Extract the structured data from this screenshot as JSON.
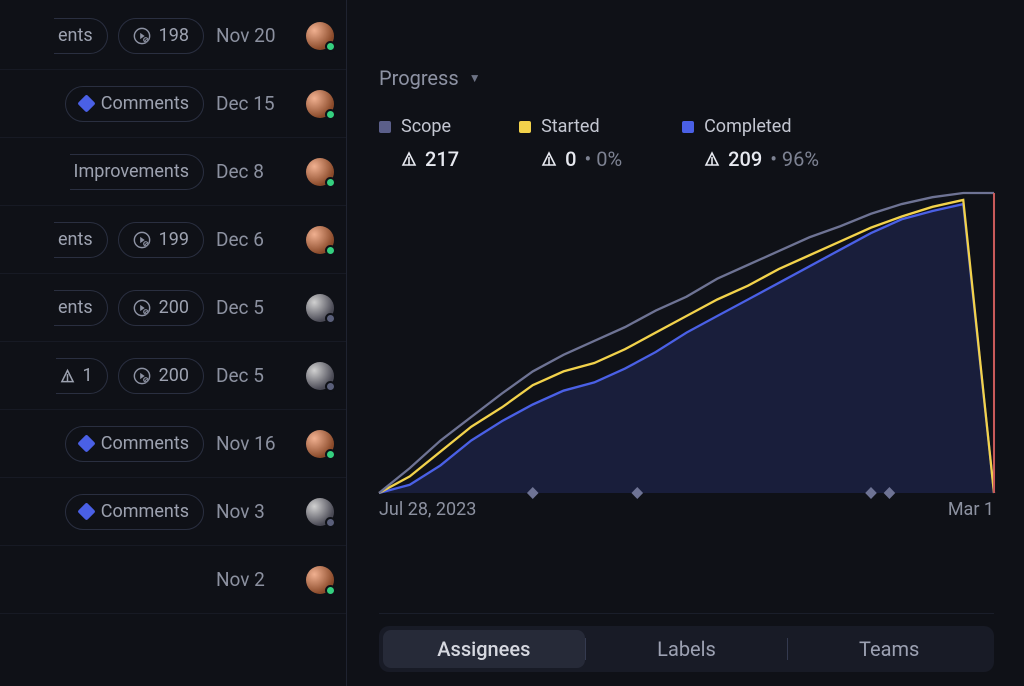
{
  "colors": {
    "scope_swatch": "#5b5f8a",
    "started_swatch": "#f2d24b",
    "completed_swatch": "#4a60e6",
    "comments_diamond": "#4a60e6",
    "chart_scope_stroke": "#6e7394",
    "chart_started_stroke": "#f2d24b",
    "chart_completed_stroke": "#4a60e6",
    "chart_completed_fill": "rgba(74,96,230,0.18)",
    "chart_deadline_stroke": "#c85a5a"
  },
  "rows": [
    {
      "chips": [
        {
          "kind": "text_trunc",
          "text": "ents"
        },
        {
          "kind": "play",
          "num": "198"
        }
      ],
      "date": "Nov 20",
      "avatar": "orange",
      "presence": "online"
    },
    {
      "chips": [
        {
          "kind": "diamond_label",
          "text": "Comments"
        }
      ],
      "date": "Dec 15",
      "avatar": "orange",
      "presence": "online"
    },
    {
      "chips": [
        {
          "kind": "text_trunc",
          "text": "Improvements"
        }
      ],
      "date": "Dec 8",
      "avatar": "orange",
      "presence": "online"
    },
    {
      "chips": [
        {
          "kind": "text_trunc",
          "text": "ents"
        },
        {
          "kind": "play",
          "num": "199"
        }
      ],
      "date": "Dec 6",
      "avatar": "orange",
      "presence": "online"
    },
    {
      "chips": [
        {
          "kind": "text_trunc",
          "text": "ents"
        },
        {
          "kind": "play",
          "num": "200"
        }
      ],
      "date": "Dec 5",
      "avatar": "gray",
      "presence": "idle"
    },
    {
      "chips": [
        {
          "kind": "tri_num",
          "num": "1"
        },
        {
          "kind": "play",
          "num": "200"
        }
      ],
      "date": "Dec 5",
      "avatar": "gray",
      "presence": "idle"
    },
    {
      "chips": [
        {
          "kind": "diamond_label",
          "text": "Comments"
        }
      ],
      "date": "Nov 16",
      "avatar": "orange",
      "presence": "online"
    },
    {
      "chips": [
        {
          "kind": "diamond_label",
          "text": "Comments"
        }
      ],
      "date": "Nov 3",
      "avatar": "gray",
      "presence": "idle"
    },
    {
      "chips": [],
      "date": "Nov 2",
      "avatar": "orange",
      "presence": "online"
    }
  ],
  "panel": {
    "title": "Progress",
    "legend": {
      "scope": {
        "label": "Scope",
        "value": "217",
        "pct": ""
      },
      "started": {
        "label": "Started",
        "value": "0",
        "pct": "0%"
      },
      "completed": {
        "label": "Completed",
        "value": "209",
        "pct": "96%"
      }
    },
    "xaxis": {
      "start": "Jul 28, 2023",
      "end": "Mar 1"
    }
  },
  "tabs": {
    "items": [
      "Assignees",
      "Labels",
      "Teams"
    ],
    "active_index": 0
  },
  "chart_data": {
    "type": "line",
    "title": "Progress",
    "x_range_label": [
      "Jul 28, 2023",
      "Mar 1"
    ],
    "ylim_estimate": [
      0,
      217
    ],
    "x": [
      0,
      5,
      10,
      15,
      20,
      25,
      30,
      35,
      40,
      45,
      50,
      55,
      60,
      65,
      70,
      75,
      80,
      85,
      90,
      95,
      100
    ],
    "series": [
      {
        "name": "Scope",
        "values": [
          0,
          18,
          38,
          55,
          72,
          88,
          100,
          110,
          120,
          132,
          142,
          155,
          165,
          175,
          185,
          193,
          202,
          209,
          214,
          217,
          217
        ]
      },
      {
        "name": "Started",
        "values": [
          0,
          12,
          30,
          48,
          62,
          78,
          88,
          94,
          104,
          116,
          128,
          140,
          150,
          162,
          172,
          182,
          192,
          200,
          207,
          212,
          0
        ]
      },
      {
        "name": "Completed",
        "values": [
          0,
          6,
          20,
          38,
          52,
          64,
          74,
          80,
          90,
          102,
          116,
          128,
          140,
          152,
          164,
          176,
          188,
          198,
          204,
          209,
          0
        ]
      }
    ],
    "markers_x": [
      25,
      42,
      80,
      83
    ],
    "deadline_x": 100
  }
}
